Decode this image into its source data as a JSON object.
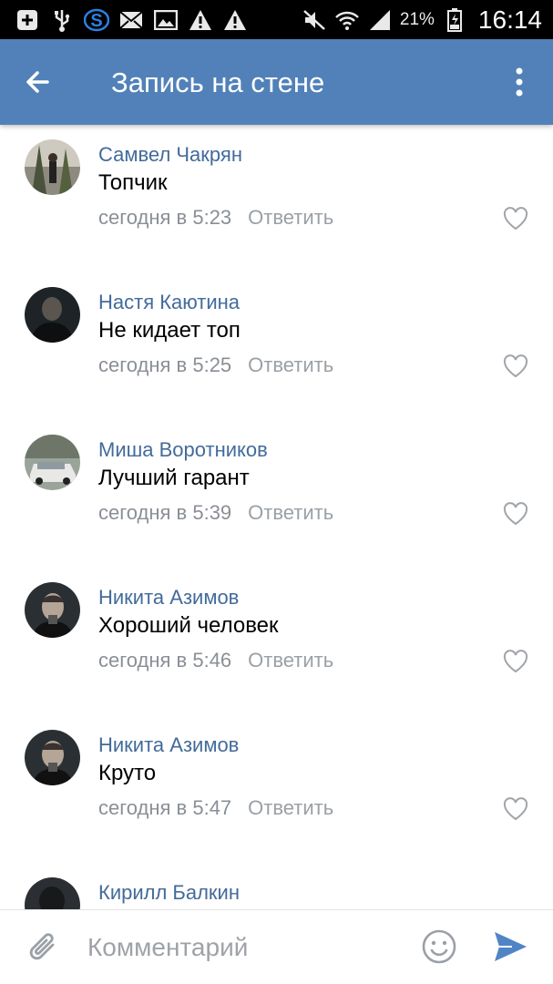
{
  "status_bar": {
    "battery": "21%",
    "time": "16:14",
    "icons": [
      "plus-square-icon",
      "usb-icon",
      "s-logo-icon",
      "mail-icon",
      "image-icon",
      "warning-icon",
      "warning-icon",
      "mute-icon",
      "wifi-icon",
      "signal-icon",
      "battery-icon"
    ]
  },
  "header": {
    "title": "Запись на стене",
    "back_icon": "arrow-left-icon",
    "menu_icon": "more-vertical-icon",
    "color": "#5181b8"
  },
  "comments": [
    {
      "author": "Самвел Чакрян",
      "text": "Топчик",
      "time": "сегодня в 5:23",
      "reply": "Ответить"
    },
    {
      "author": "Настя Каютина",
      "text": "Не кидает топ",
      "time": "сегодня в 5:25",
      "reply": "Ответить"
    },
    {
      "author": "Миша Воротников",
      "text": "Лучший гарант",
      "time": "сегодня в 5:39",
      "reply": "Ответить"
    },
    {
      "author": "Никита Азимов",
      "text": "Хороший человек",
      "time": "сегодня в 5:46",
      "reply": "Ответить"
    },
    {
      "author": "Никита Азимов",
      "text": "Круто",
      "time": "сегодня в 5:47",
      "reply": "Ответить"
    },
    {
      "author": "Кирилл Балкин",
      "text": "",
      "time": "",
      "reply": ""
    }
  ],
  "composer": {
    "placeholder": "Комментарий",
    "attach_icon": "paperclip-icon",
    "emoji_icon": "smiley-icon",
    "send_icon": "send-icon"
  }
}
